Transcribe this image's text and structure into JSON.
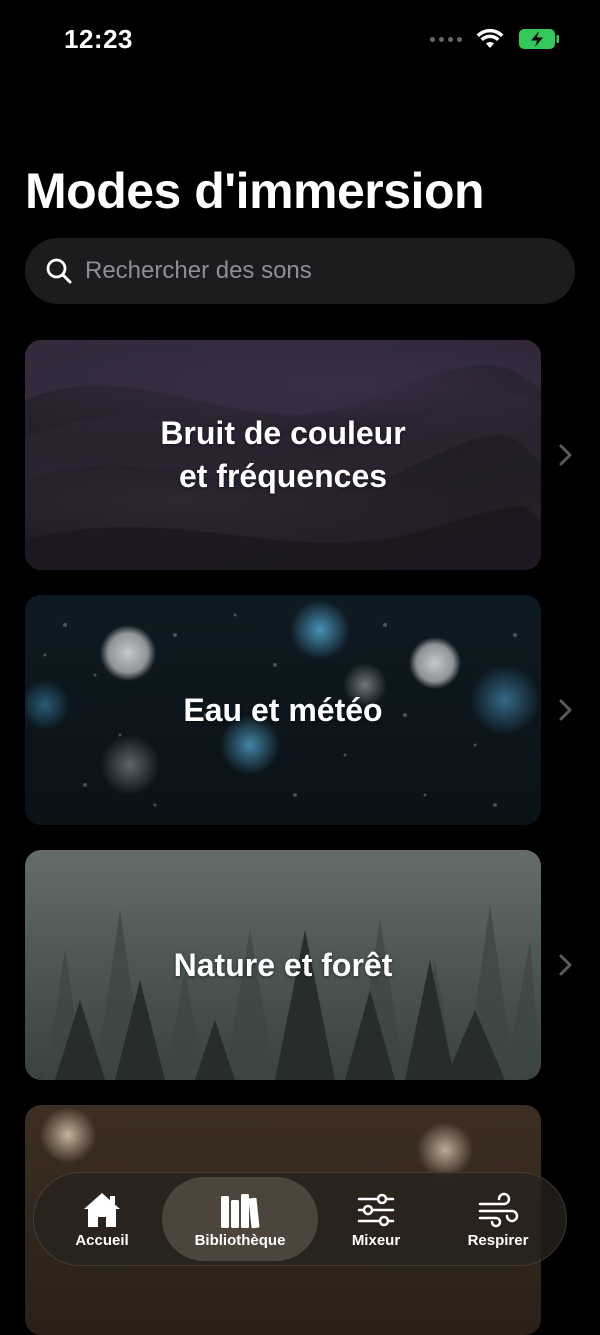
{
  "status_bar": {
    "time": "12:23"
  },
  "page": {
    "title": "Modes d'immersion"
  },
  "search": {
    "placeholder": "Rechercher des sons",
    "value": ""
  },
  "categories": [
    {
      "line1": "Bruit de couleur",
      "line2": "et fréquences"
    },
    {
      "line1": "Eau et météo",
      "line2": ""
    },
    {
      "line1": "Nature et forêt",
      "line2": ""
    },
    {
      "line1": "",
      "line2": ""
    }
  ],
  "tab_bar": {
    "tabs": [
      {
        "label": "Accueil",
        "icon": "home-icon",
        "active": false
      },
      {
        "label": "Bibliothèque",
        "icon": "library-icon",
        "active": true
      },
      {
        "label": "Mixeur",
        "icon": "sliders-icon",
        "active": false
      },
      {
        "label": "Respirer",
        "icon": "wind-icon",
        "active": false
      }
    ]
  },
  "colors": {
    "background": "#000000",
    "search_bg": "#1c1c1e",
    "placeholder": "#8e8e93",
    "battery": "#34c759"
  }
}
